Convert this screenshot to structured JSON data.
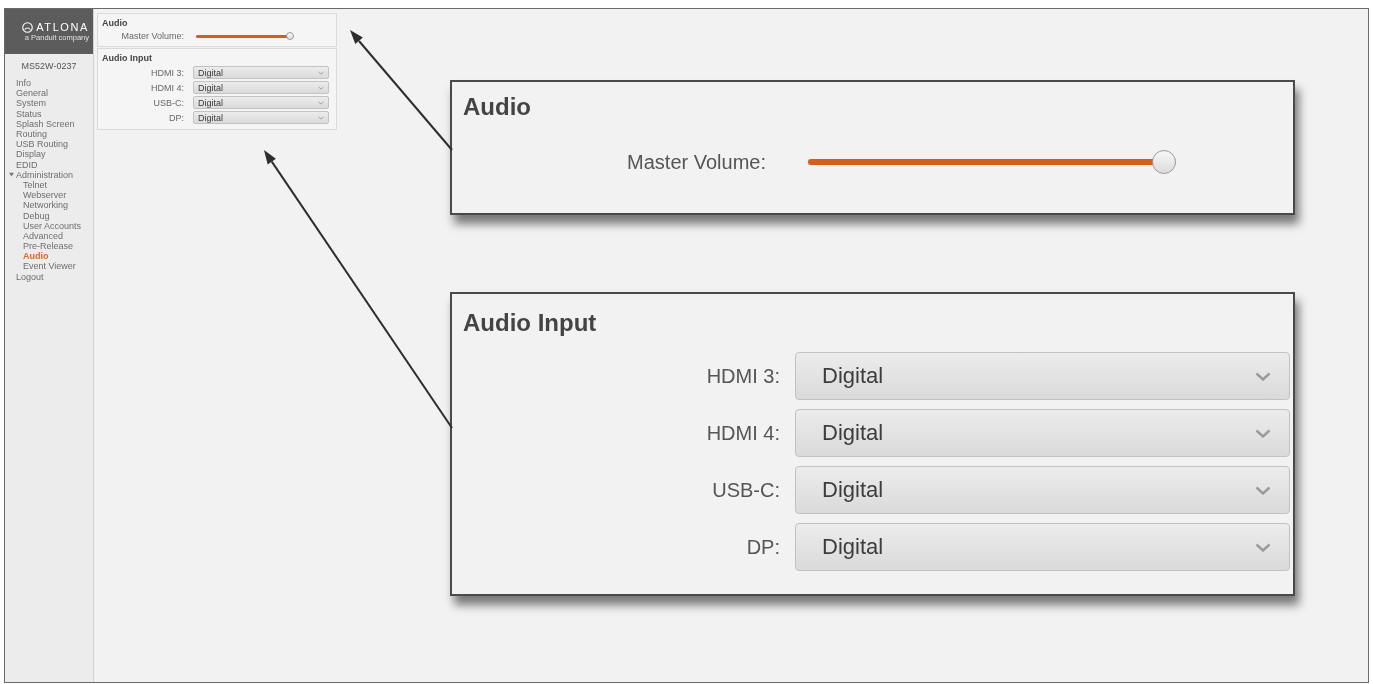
{
  "sidebar": {
    "logo": {
      "brand": "ATLONA",
      "tagline": "a Panduit company"
    },
    "device_name": "MS52W-0237",
    "items": [
      {
        "label": "Info",
        "selected": false
      },
      {
        "label": "General",
        "selected": false
      },
      {
        "label": "System",
        "selected": false
      },
      {
        "label": "Status",
        "selected": false
      },
      {
        "label": "Splash Screen",
        "selected": false
      },
      {
        "label": "Routing",
        "selected": false
      },
      {
        "label": "USB Routing",
        "selected": false
      },
      {
        "label": "Display",
        "selected": false
      },
      {
        "label": "EDID",
        "selected": false
      },
      {
        "label": "Administration",
        "selected": false,
        "expanded": true,
        "children": [
          {
            "label": "Telnet",
            "selected": false
          },
          {
            "label": "Webserver",
            "selected": false
          },
          {
            "label": "Networking",
            "selected": false
          },
          {
            "label": "Debug",
            "selected": false
          },
          {
            "label": "User Accounts",
            "selected": false
          },
          {
            "label": "Advanced",
            "selected": false
          },
          {
            "label": "Pre-Release",
            "selected": false
          },
          {
            "label": "Audio",
            "selected": true
          },
          {
            "label": "Event Viewer",
            "selected": false
          }
        ]
      },
      {
        "label": "Logout",
        "selected": false
      }
    ]
  },
  "panel": {
    "sections": [
      {
        "kind": "volume",
        "title": "Audio",
        "label": "Master Volume:",
        "level": 1
      },
      {
        "kind": "inputs",
        "title": "Audio Input",
        "inputs": [
          {
            "label": "HDMI 3:",
            "value": "Digital"
          },
          {
            "label": "HDMI 4:",
            "value": "Digital"
          },
          {
            "label": "USB-C:",
            "value": "Digital"
          },
          {
            "label": "DP:",
            "value": "Digital"
          }
        ]
      }
    ]
  },
  "callouts": [
    {
      "kind": "volume",
      "title": "Audio",
      "label": "Master Volume:",
      "level": 1
    },
    {
      "kind": "inputs",
      "title": "Audio Input",
      "inputs": [
        {
          "label": "HDMI 3:",
          "value": "Digital"
        },
        {
          "label": "HDMI 4:",
          "value": "Digital"
        },
        {
          "label": "USB-C:",
          "value": "Digital"
        },
        {
          "label": "DP:",
          "value": "Digital"
        }
      ]
    }
  ]
}
